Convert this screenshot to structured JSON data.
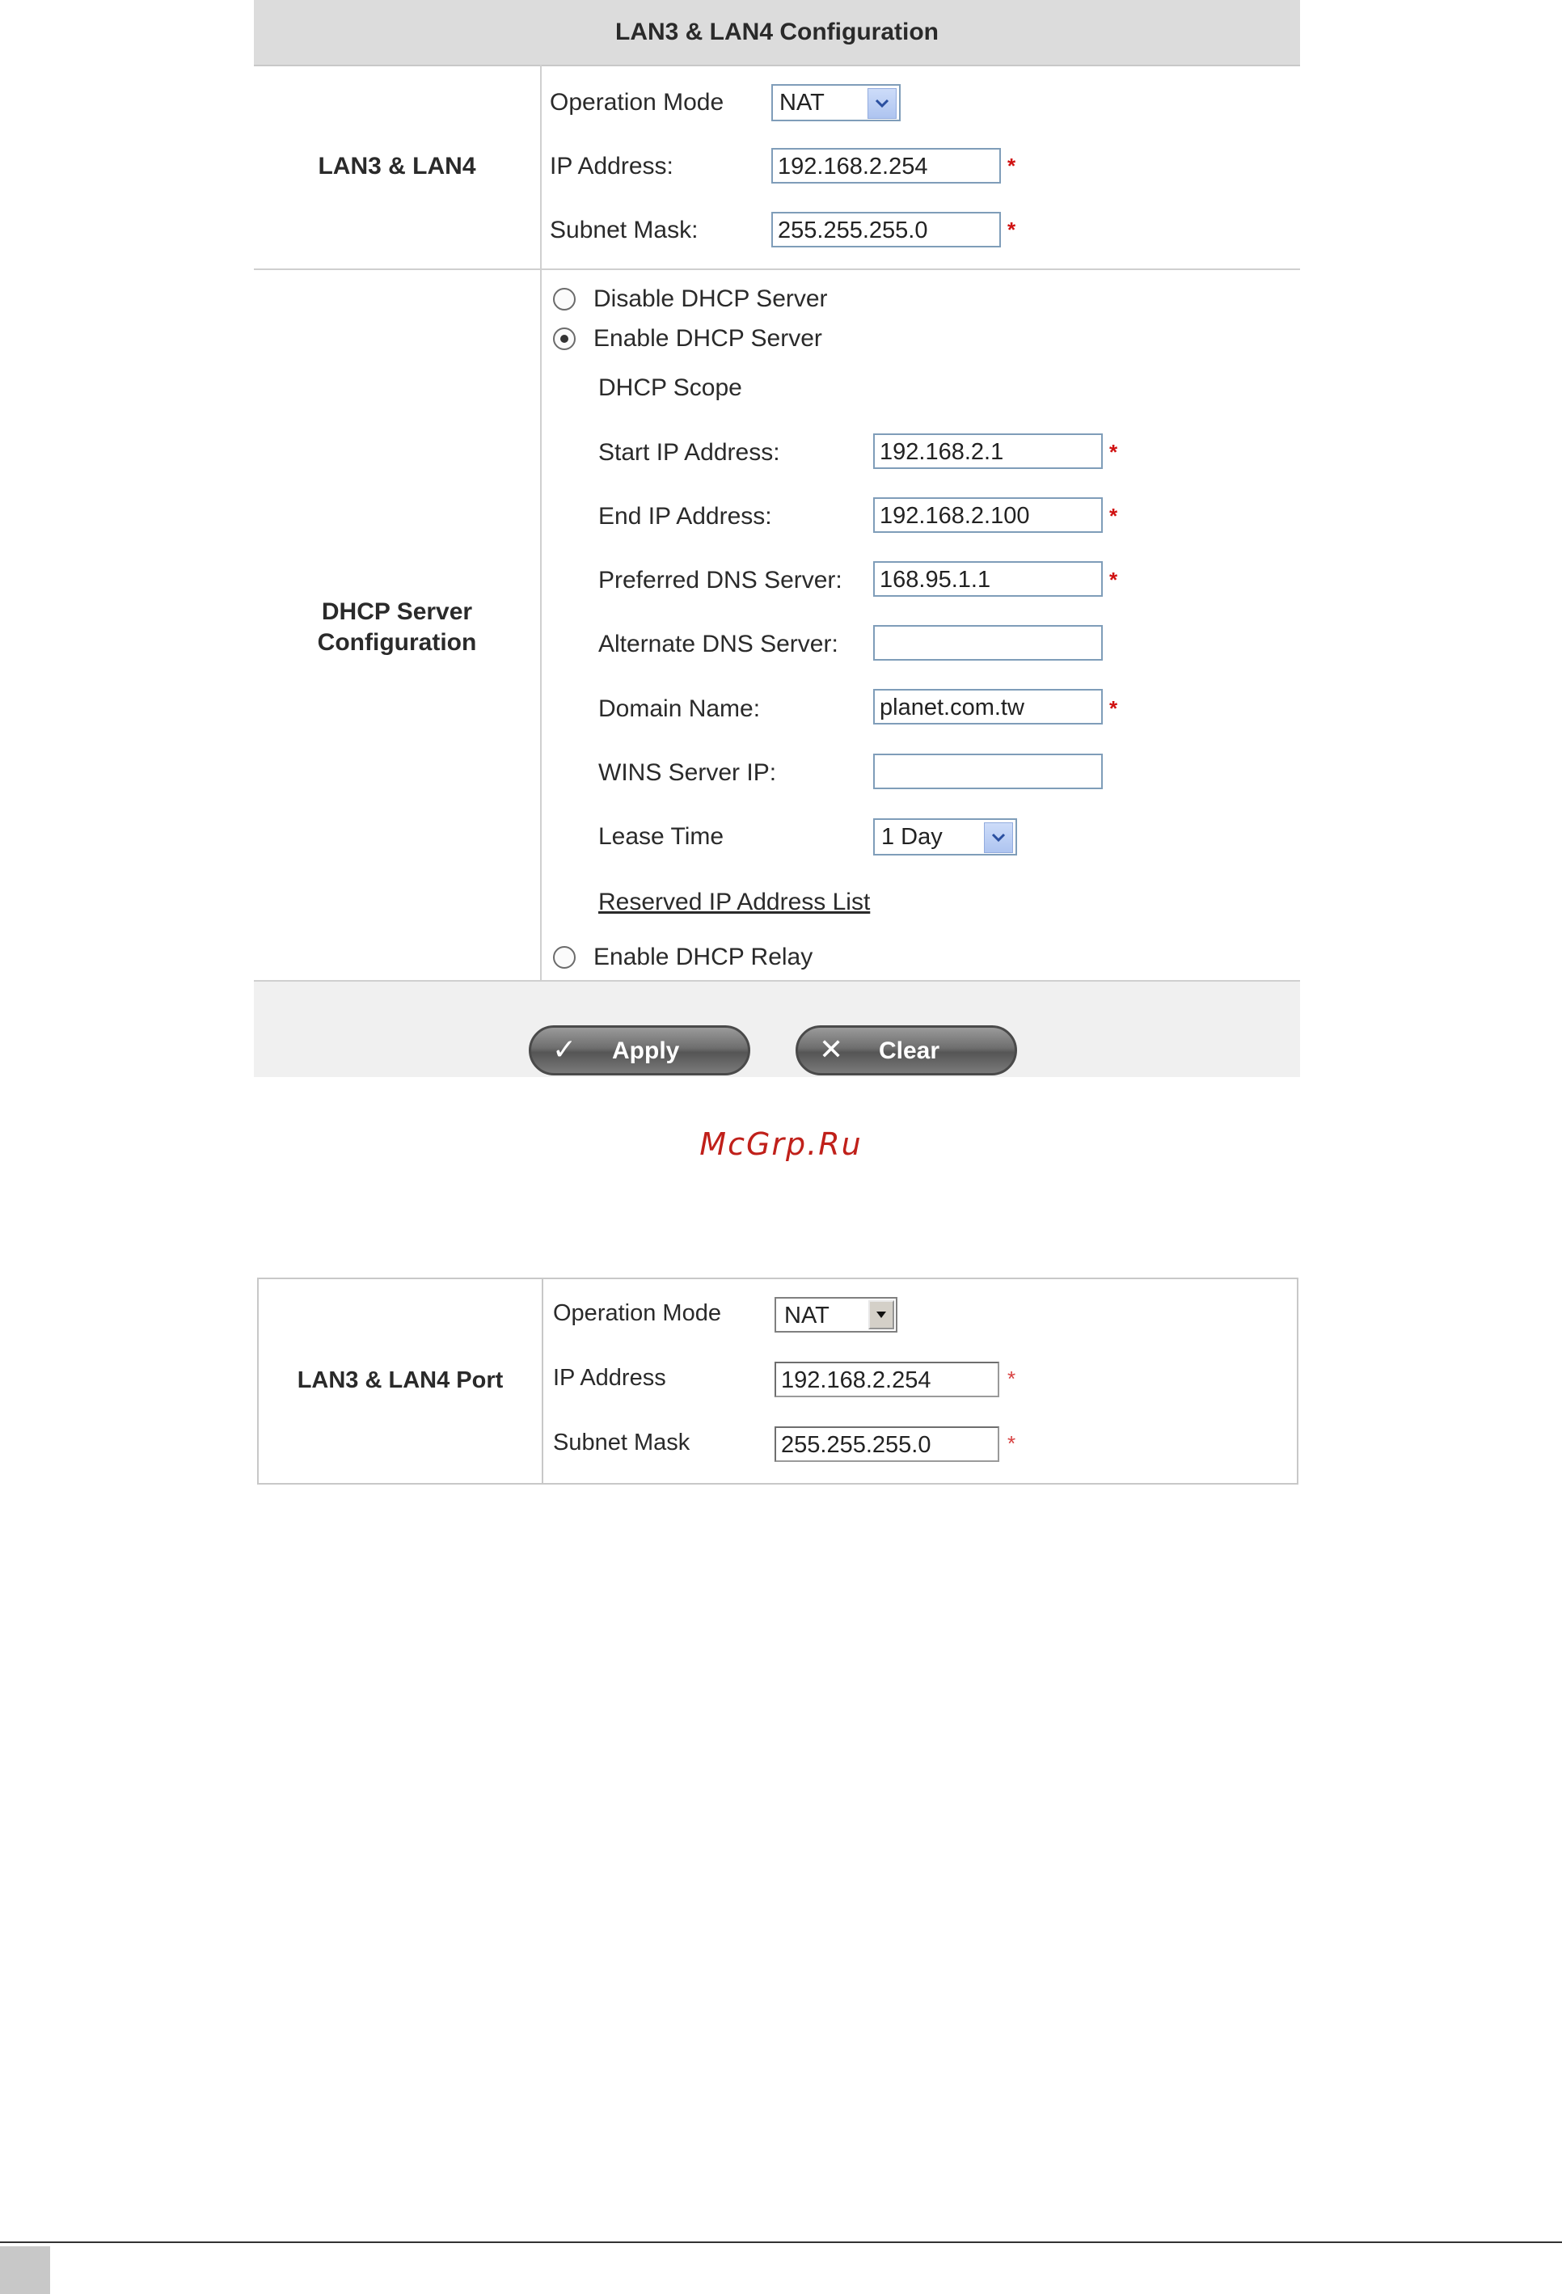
{
  "panel1": {
    "header": "LAN3 & LAN4 Configuration",
    "lan_section": {
      "label": "LAN3 & LAN4",
      "operation_mode_label": "Operation Mode",
      "operation_mode_value": "NAT",
      "ip_label": "IP Address:",
      "ip_value": "192.168.2.254",
      "mask_label": "Subnet Mask:",
      "mask_value": "255.255.255.0"
    },
    "dhcp_section": {
      "label_line1": "DHCP Server",
      "label_line2": "Configuration",
      "disable_label": "Disable DHCP Server",
      "enable_label": "Enable DHCP Server",
      "scope_label": "DHCP Scope",
      "start_ip_label": "Start IP Address:",
      "start_ip_value": "192.168.2.1",
      "end_ip_label": "End IP Address:",
      "end_ip_value": "192.168.2.100",
      "pref_dns_label": "Preferred DNS Server:",
      "pref_dns_value": "168.95.1.1",
      "alt_dns_label": "Alternate DNS Server:",
      "alt_dns_value": "",
      "domain_label": "Domain Name:",
      "domain_value": "planet.com.tw",
      "wins_label": "WINS Server IP:",
      "wins_value": "",
      "lease_label": "Lease Time",
      "lease_value": "1 Day",
      "reserved_link": "Reserved IP Address List",
      "relay_label": "Enable DHCP Relay",
      "selected_mode": "Enable DHCP Server"
    },
    "required_mark": "*",
    "apply_label": "Apply",
    "clear_label": "Clear"
  },
  "watermark": "McGrp.Ru",
  "panel2": {
    "label": "LAN3 & LAN4 Port",
    "operation_mode_label": "Operation Mode",
    "operation_mode_value": "NAT",
    "ip_label": "IP Address",
    "ip_value": "192.168.2.254",
    "mask_label": "Subnet Mask",
    "mask_value": "255.255.255.0"
  }
}
